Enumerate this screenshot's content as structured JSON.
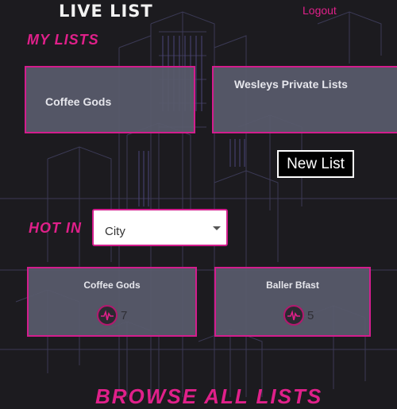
{
  "header": {
    "logo_text": "LIVE LIST",
    "logout_label": "Logout"
  },
  "my_lists": {
    "title": "MY LISTS",
    "items": [
      {
        "name": "Coffee Gods"
      },
      {
        "name": "Wesleys Private Lists"
      }
    ],
    "new_list_label": "New List"
  },
  "hot_in": {
    "title": "HOT IN",
    "select_value": "City",
    "items": [
      {
        "name": "Coffee Gods",
        "score": "7"
      },
      {
        "name": "Baller Bfast",
        "score": "5"
      }
    ]
  },
  "browse": {
    "title": "BROWSE ALL LISTS"
  },
  "colors": {
    "accent": "#e0208a",
    "card_bg": "#585a6c",
    "background": "#1c1b1f"
  },
  "icons": {
    "score": "pulse-icon",
    "dropdown": "chevron-down-icon"
  }
}
